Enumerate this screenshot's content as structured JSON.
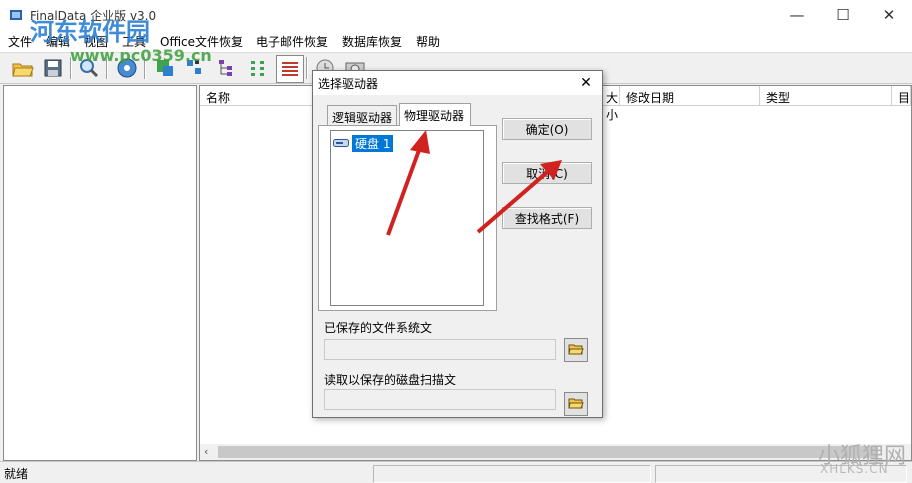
{
  "window": {
    "title": "FinalData 企业版 v3.0",
    "controls": {
      "minimize": "—",
      "maximize": "☐",
      "close": "✕"
    }
  },
  "menu": [
    "文件",
    "编辑",
    "视图",
    "工具",
    "Office文件恢复",
    "电子邮件恢复",
    "数据库恢复",
    "帮助"
  ],
  "toolbar": {
    "icons": [
      "open-folder-icon",
      "save-icon",
      "search-icon",
      "disc-icon",
      "view-large-icon",
      "view-small-icon",
      "view-tree-icon",
      "view-list-icon",
      "view-details-icon",
      "clock-icon",
      "camera-icon"
    ]
  },
  "list": {
    "columns": [
      "名称",
      "大小",
      "修改日期",
      "类型",
      "目"
    ]
  },
  "status": {
    "text": "就绪"
  },
  "dialog": {
    "title": "选择驱动器",
    "close": "✕",
    "tabs": [
      "逻辑驱动器",
      "物理驱动器"
    ],
    "active_tab": "物理驱动器",
    "tree_item": "硬盘 1",
    "buttons": {
      "ok": "确定(O)",
      "cancel": "取消(C)",
      "find_format": "查找格式(F)"
    },
    "saved_fs_label": "已保存的文件系统文",
    "saved_fs_value": "",
    "scan_label": "读取以保存的磁盘扫描文",
    "scan_value": ""
  },
  "watermarks": {
    "top_left": "河东软件园",
    "top_left_url": "www.pc0359.cn",
    "bottom_right": "小狐狸网",
    "bottom_right_url": "XHLKS.CN"
  },
  "colors": {
    "selection": "#0078d7",
    "arrow": "#d0221f"
  }
}
